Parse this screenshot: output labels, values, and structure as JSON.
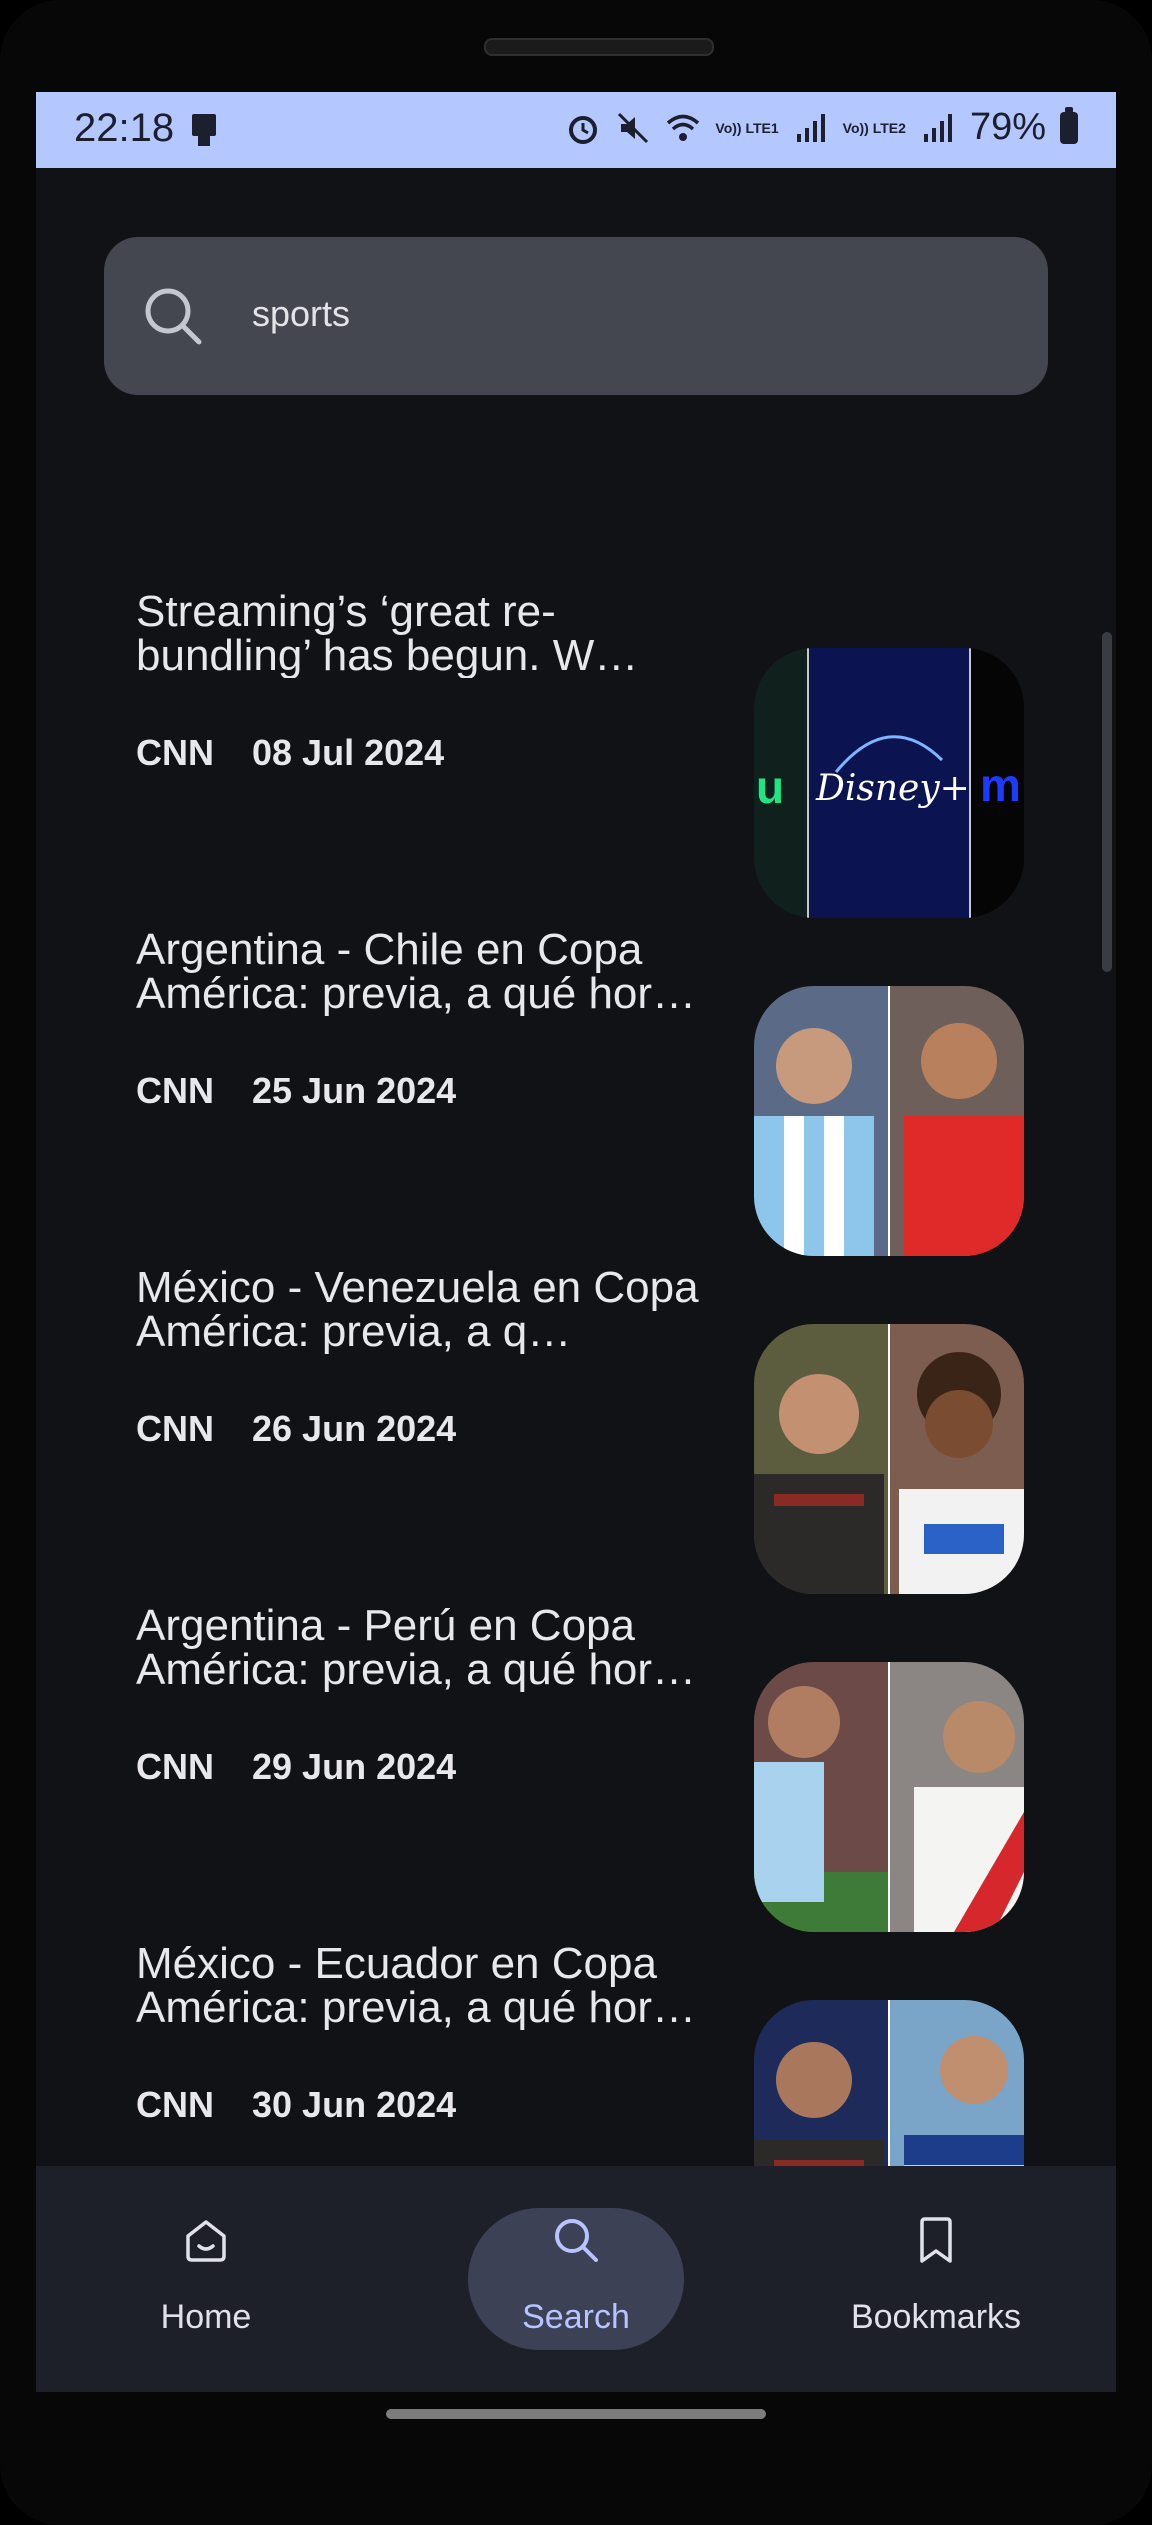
{
  "status_bar": {
    "time": "22:18",
    "network1": "Vo)) LTE1",
    "network2": "Vo)) LTE2",
    "battery": "79%"
  },
  "search": {
    "value": "sports",
    "icon": "search-icon"
  },
  "articles": [
    {
      "title": "Streaming’s ‘great re-bundling’ has begun. W…",
      "source": "CNN",
      "date": "08 Jul 2024"
    },
    {
      "title": "Argentina - Chile en Copa América: previa, a qué hor…",
      "source": "CNN",
      "date": "25 Jun 2024"
    },
    {
      "title": "México - Venezuela en Copa América: previa, a q…",
      "source": "CNN",
      "date": "26 Jun 2024"
    },
    {
      "title": "Argentina - Perú en Copa América: previa, a qué hor…",
      "source": "CNN",
      "date": "29 Jun 2024"
    },
    {
      "title": "México - Ecuador en Copa América: previa, a qué hor…",
      "source": "CNN",
      "date": "30 Jun 2024"
    }
  ],
  "nav": {
    "home": "Home",
    "search": "Search",
    "bookmarks": "Bookmarks",
    "active": "search"
  },
  "colors": {
    "background": "#111216",
    "status_bar": "#b5c7ff",
    "search_field": "#44474f",
    "nav_bar": "#1d2029",
    "nav_active_pill": "#3d4155",
    "nav_active_text": "#b7c4ff"
  }
}
